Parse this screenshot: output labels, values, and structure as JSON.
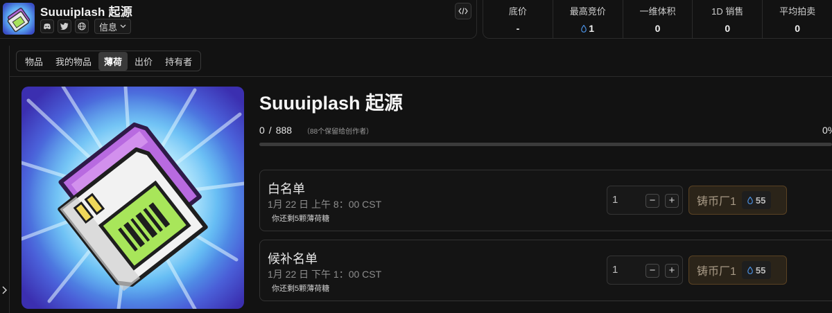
{
  "collection": {
    "title": "Suuuiplash 起源",
    "info_label": "信息",
    "socials": [
      "discord-icon",
      "twitter-icon",
      "globe-icon"
    ]
  },
  "stats": [
    {
      "label": "底价",
      "value": "-",
      "icon": null
    },
    {
      "label": "最高竞价",
      "value": "1",
      "icon": "drop-icon"
    },
    {
      "label": "一维体积",
      "value": "0",
      "icon": null
    },
    {
      "label": "1D 销售",
      "value": "0",
      "icon": null
    },
    {
      "label": "平均拍卖",
      "value": "0",
      "icon": null
    }
  ],
  "tabs": [
    {
      "label": "物品",
      "active": false
    },
    {
      "label": "我的物品",
      "active": false
    },
    {
      "label": "薄荷",
      "active": true
    },
    {
      "label": "出价",
      "active": false
    },
    {
      "label": "持有者",
      "active": false
    }
  ],
  "mint": {
    "title": "Suuuiplash 起源",
    "minted": "0",
    "separator": "/",
    "supply": "888",
    "reserved_note": "（88个保留给创作者）",
    "percent": "0%",
    "progress_fraction": 0
  },
  "phases": [
    {
      "name": "白名单",
      "time": "1月 22 日 上午 8：00 CST",
      "note": "你还剩5颗薄荷糖",
      "quantity": "1",
      "minus": "−",
      "plus": "+",
      "button_label": "铸币厂1",
      "price": "55"
    },
    {
      "name": "候补名单",
      "time": "1月 22 日 下午 1：00 CST",
      "note": "你还剩5颗薄荷糖",
      "quantity": "1",
      "minus": "−",
      "plus": "+",
      "button_label": "铸币厂1",
      "price": "55"
    }
  ],
  "colors": {
    "background": "#121212",
    "accent_drop": "#4a90e2",
    "mint_button_border": "#5a4223",
    "progress_fill": "#8a5cf6"
  }
}
